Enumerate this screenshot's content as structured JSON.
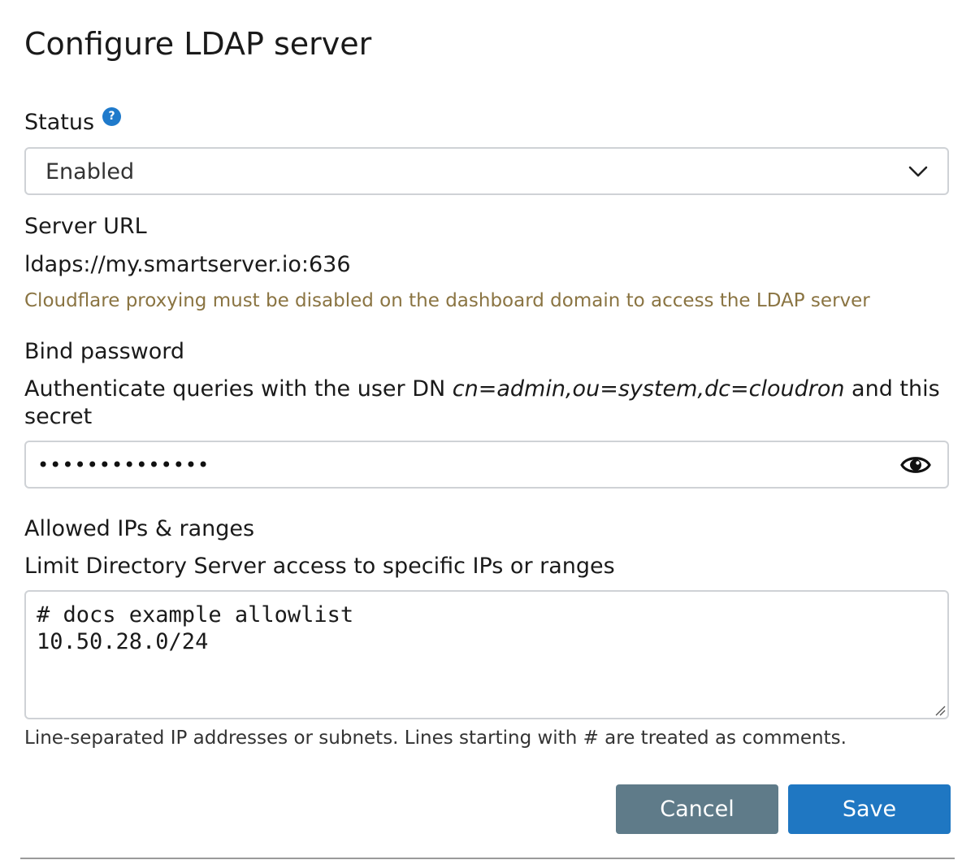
{
  "dialog": {
    "title": "Configure LDAP server"
  },
  "status": {
    "label": "Status",
    "help_icon": "question-circle-icon",
    "selected": "Enabled"
  },
  "server_url": {
    "label": "Server URL",
    "value": "ldaps://my.smartserver.io:636",
    "warning": "Cloudflare proxying must be disabled on the dashboard domain to access the LDAP server"
  },
  "bind_password": {
    "label": "Bind password",
    "description_prefix": "Authenticate queries with the user DN ",
    "user_dn": "cn=admin,ou=system,dc=cloudron",
    "description_middle": " and this",
    "description_suffix": "secret",
    "masked_value": "••••••••••••••",
    "toggle_icon": "eye-icon"
  },
  "allowed_ips": {
    "label": "Allowed IPs & ranges",
    "description": "Limit Directory Server access to specific IPs or ranges",
    "lines": [
      "# docs example allowlist",
      "10.50.28.0/24"
    ],
    "hint": "Line-separated IP addresses or subnets. Lines starting with # are treated as comments."
  },
  "actions": {
    "cancel_label": "Cancel",
    "save_label": "Save"
  },
  "colors": {
    "primary": "#1f77c2",
    "secondary": "#5f7b89",
    "warning_text": "#8a7442",
    "border": "#cfd2d6"
  }
}
